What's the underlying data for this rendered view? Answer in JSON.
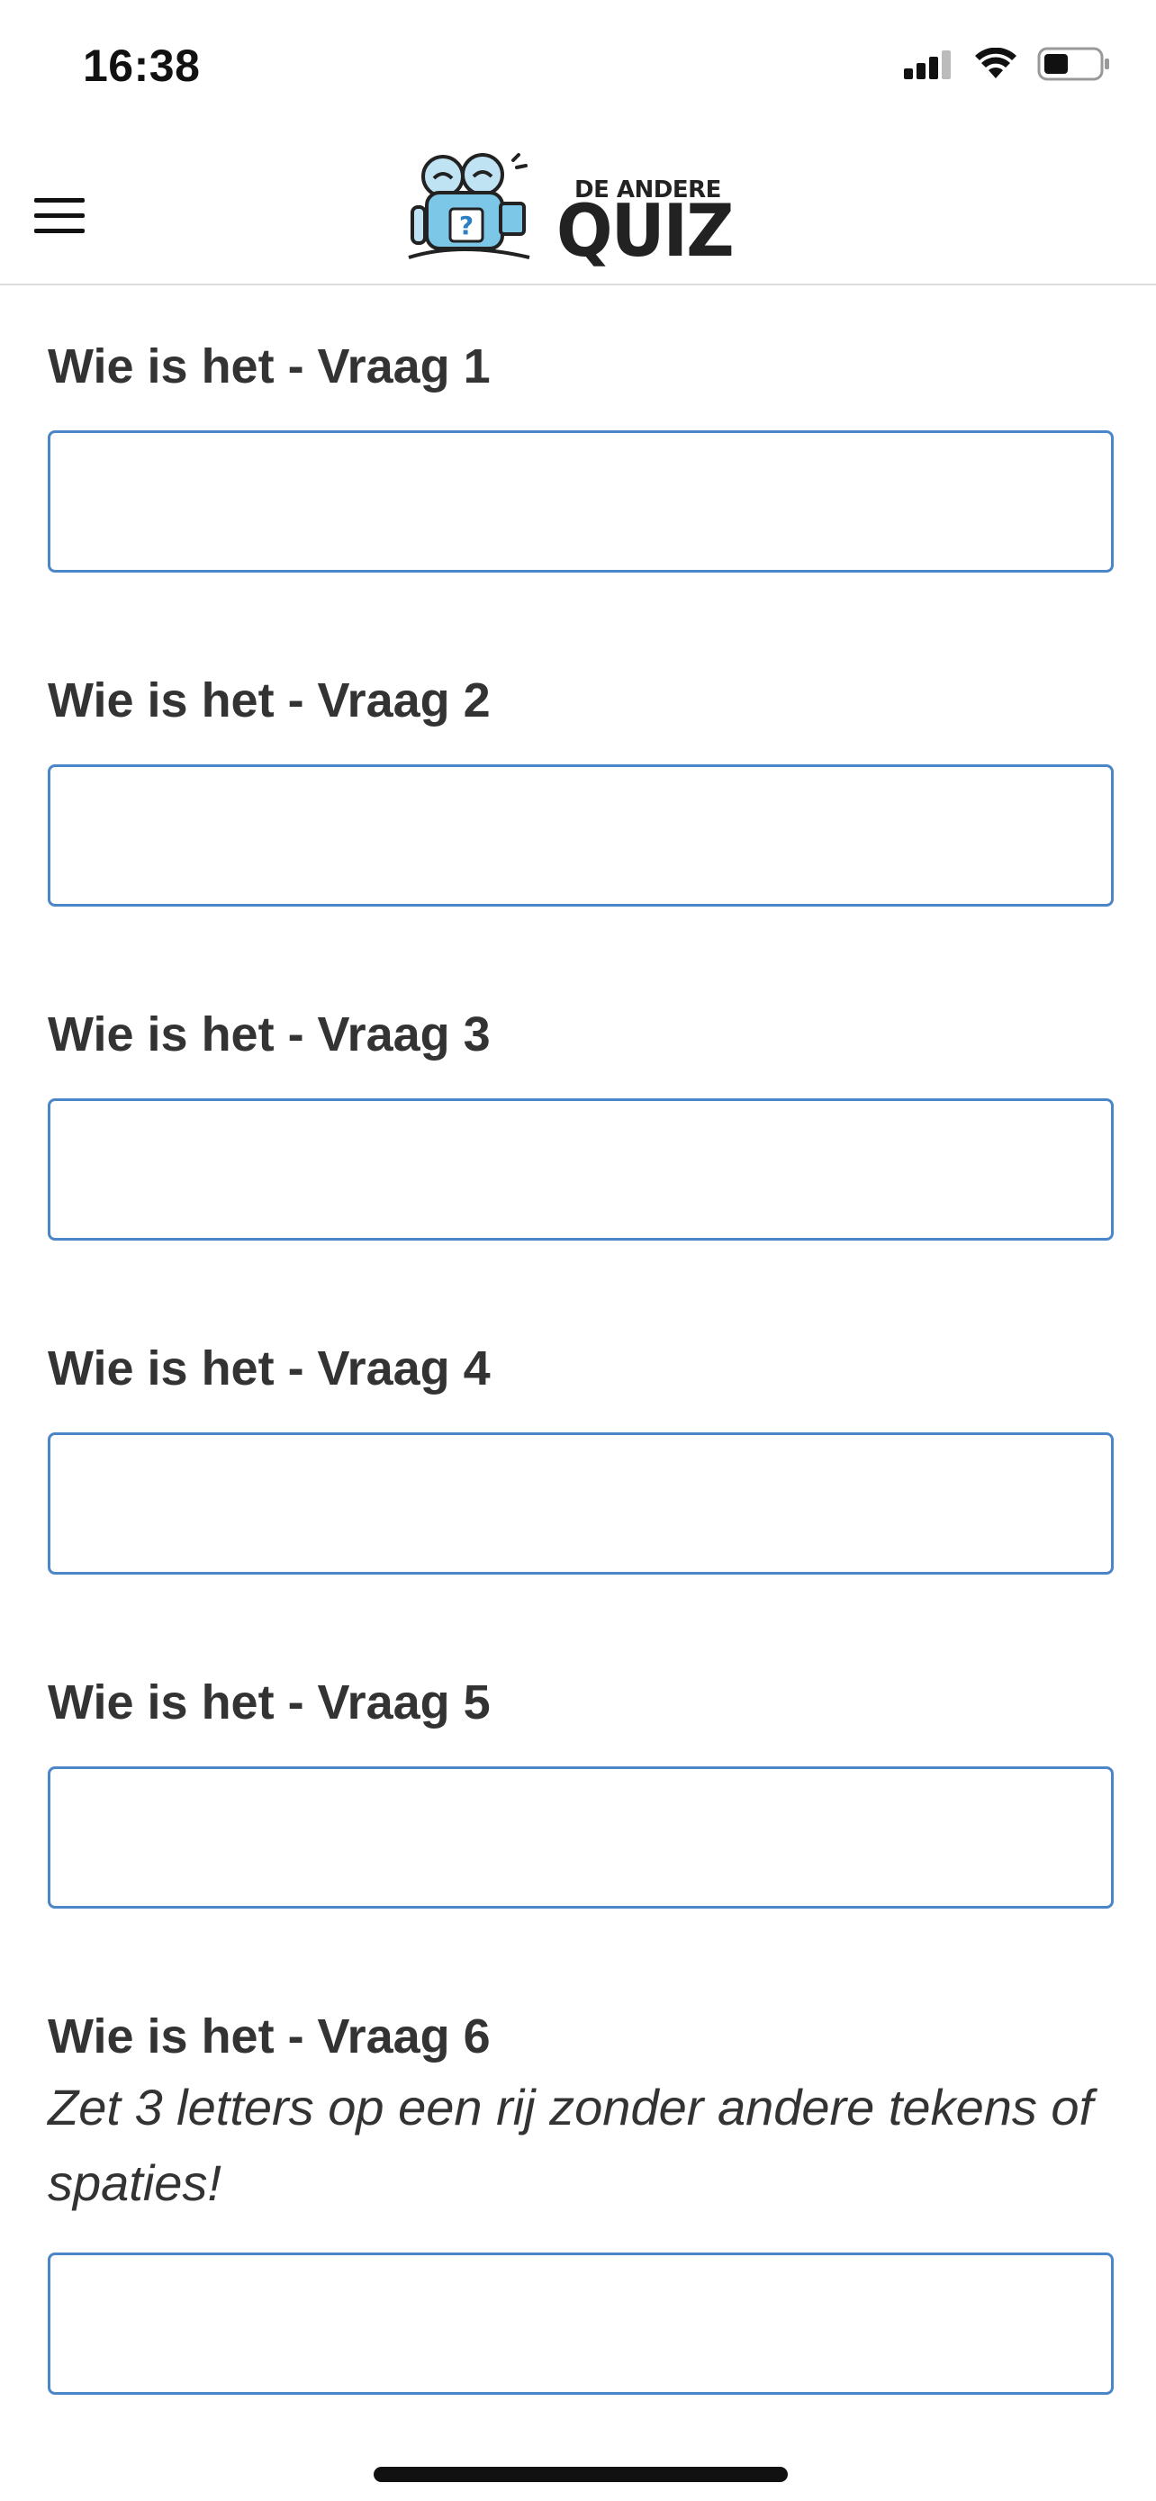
{
  "status_bar": {
    "time": "16:38"
  },
  "header": {
    "logo_line1": "DE ANDERE",
    "logo_line2": "QUIZ"
  },
  "questions": [
    {
      "label": "Wie is het - Vraag 1",
      "value": ""
    },
    {
      "label": "Wie is het - Vraag 2",
      "value": ""
    },
    {
      "label": "Wie is het - Vraag 3",
      "value": ""
    },
    {
      "label": "Wie is het - Vraag 4",
      "value": ""
    },
    {
      "label": "Wie is het - Vraag 5",
      "value": ""
    },
    {
      "label": "Wie is het - Vraag 6",
      "hint": "Zet 3 letters op een rij zonder andere tekens of spaties!",
      "value": ""
    }
  ],
  "colors": {
    "input_border": "#4a86c8",
    "text": "#333333",
    "header_divider": "#dddddd"
  }
}
